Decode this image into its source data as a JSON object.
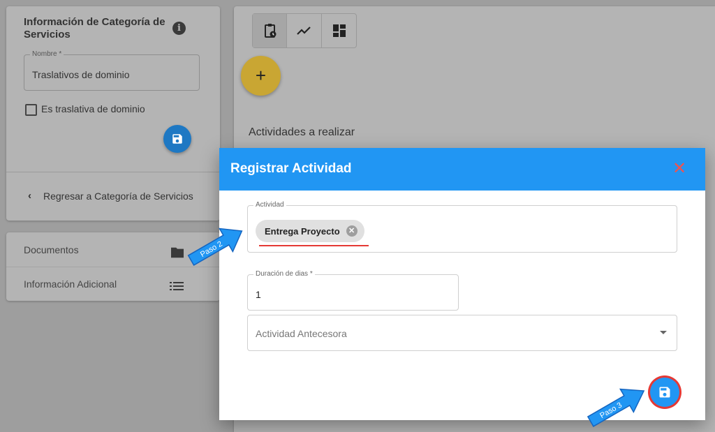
{
  "category_panel": {
    "title": "Información de Categoría de Servicios",
    "nombre_label": "Nombre *",
    "nombre_value": "Traslativos de dominio",
    "checkbox_label": "Es traslativa de dominio",
    "back_label": "Regresar a Categoría de Servicios"
  },
  "side_list": {
    "items": [
      {
        "label": "Documentos",
        "icon": "folder-icon"
      },
      {
        "label": "Información Adicional",
        "icon": "list-icon"
      }
    ]
  },
  "main": {
    "tools": [
      "clipboard-clock-icon",
      "trend-line-icon",
      "dashboard-icon"
    ],
    "add_label": "+",
    "section_title": "Actividades a realizar"
  },
  "dialog": {
    "title": "Registrar Actividad",
    "close_label": "✕",
    "actividad_label": "Actividad",
    "actividad_chip": "Entrega Proyecto",
    "duracion_label": "Duración de dias *",
    "duracion_value": "1",
    "antecesora_placeholder": "Actividad Antecesora"
  },
  "annotations": {
    "step2": "Paso 2",
    "step3": "Paso 3"
  },
  "colors": {
    "primary": "#2196f3",
    "accent_fab": "#c9a633",
    "highlight": "#e53935"
  }
}
